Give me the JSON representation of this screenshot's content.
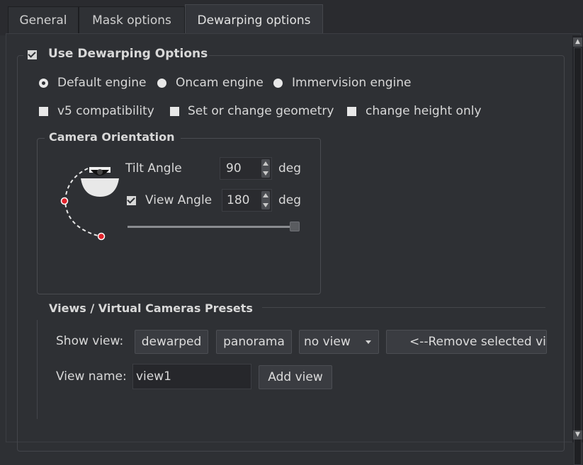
{
  "tabs": [
    {
      "label": "General"
    },
    {
      "label": "Mask options"
    },
    {
      "label": "Dewarping options"
    }
  ],
  "dewarping": {
    "use_label": "Use Dewarping Options",
    "use_checked": true,
    "engines": [
      {
        "label": "Default engine",
        "checked": true
      },
      {
        "label": "Oncam engine",
        "checked": false
      },
      {
        "label": "Immervision engine",
        "checked": false
      }
    ],
    "options": [
      {
        "label": "v5 compatibility",
        "checked": false
      },
      {
        "label": "Set or change geometry",
        "checked": false
      },
      {
        "label": "change height only",
        "checked": false
      }
    ]
  },
  "camera_orientation": {
    "title": "Camera Orientation",
    "tilt_label": "Tilt Angle",
    "tilt_value": "90",
    "tilt_unit": "deg",
    "view_angle_label": "View Angle",
    "view_angle_checked": true,
    "view_angle_value": "180",
    "view_angle_unit": "deg",
    "slider_fraction": 1.0
  },
  "views": {
    "title": "Views / Virtual Cameras  Presets",
    "show_view_label": "Show view:",
    "dewarped_button": "dewarped",
    "panorama_button": "panorama",
    "view_select_value": "no view",
    "remove_button": "<--Remove selected vi",
    "view_name_label": "View name:",
    "view_name_value": "view1",
    "add_view_button": "Add view"
  },
  "colors": {
    "background": "#2e3034",
    "accent_red": "#e0222b"
  }
}
